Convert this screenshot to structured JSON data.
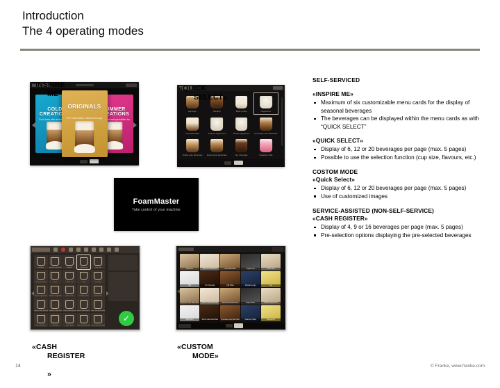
{
  "header": {
    "title_line1": "Introduction",
    "title_line2": "The 4 operating modes"
  },
  "captions": {
    "inspire_me": "\"INSPIRE",
    "inspire_me_cont": "ME\"",
    "quick_select": "«QUICK",
    "quick_select_cont": "SELECT»",
    "cash_register": "«CASH",
    "cash_register_cont": "REGISTER",
    "cash_register_cont2": "»",
    "custom_mode": "«CUSTOM",
    "custom_mode_cont": "MODE»"
  },
  "screenshots": {
    "inspire": {
      "cards": [
        {
          "title": "COLD CREATIONS",
          "subtitle": "Cool down with refreshing iced beverages"
        },
        {
          "title": "ORIGINALS",
          "subtitle": "The Foammaster classic beverage range"
        },
        {
          "title": "SUMMER CREATIONS",
          "subtitle": "Fresh seasonal specialities for hot days"
        }
      ]
    },
    "quick_select": {
      "beverages": [
        "Espresso",
        "Ristretto",
        "Black Coffee",
        "Cappuccino",
        "Latte Macchiato",
        "Caramel Cappuccino",
        "Vanilla Cappuccino",
        "Chocolate Latte Macchiato",
        "Vanilla Latte Macchiato",
        "Mokka Latte Macchiato",
        "Hot Chocolate",
        "Strawberry Milk"
      ],
      "selected": "Cappuccino"
    },
    "foam_master": {
      "title": "FoamMaster",
      "subtitle": "Take control of your machine"
    },
    "cash_register": {
      "beverages": [
        "Espresso",
        "Espresso Macchiato",
        "Ristretto",
        "Cappuccino",
        "Caffe Latte",
        "Latte Macchiato",
        "Tea Pot",
        "Coffee Pot",
        "Milk",
        "Hot Water",
        "Vanilla Cappuccino",
        "Caramel Cappuccino",
        "Choco Latte",
        "Caramel Latte",
        "Mocha Latte",
        "Vanilla Latte Macchiato",
        "Caramel Latte Macchiato",
        "Choco Latte Macchiato",
        "Mocha Latte Macchiato",
        "Nut Latte Macchiato",
        "Hot Chocolate",
        "Chocolate",
        "Milk Foam",
        "Iced Latte Macchiato",
        "Iced Latte Macchiato"
      ],
      "selected": "Cappuccino",
      "confirm_icon": "check-icon"
    },
    "custom_mode": {
      "beverages": [
        "Espresso",
        "Espresso Macchiato",
        "Latte Macchiato",
        "Cappuccino",
        "Caffe Latte",
        "Milk",
        "Hot Chocolate",
        "Flat White",
        "Ristretto Lungo",
        "Tea",
        "Espresso Latte Macchiato",
        "Mocha Latte Macchiato",
        "Mocha Latte Macchiato",
        "Milky Coffee",
        "Vanilla Cappuccino",
        "Milk Foam",
        "Mocha Latte Macchiato",
        "Chocolate Latte Macchiato",
        "Steamed Coffee",
        "Cappuccino"
      ]
    }
  },
  "body": {
    "section1_heading": "SELF-SERVICED",
    "section1_sub1": "«INSPIRE ME»",
    "section1_sub1_bullets": [
      "Maximum of six customizable menu cards for the display of seasonal beverages",
      "The beverages can be displayed within the menu cards as with “QUICK SELECT”"
    ],
    "section1_sub2": "«QUICK SELECT»",
    "section1_sub2_bullets": [
      "Display of 6, 12 or 20 beverages per page (max. 5 pages)",
      "Possible to use the selection function (cup size, flavours, etc.)"
    ],
    "section2_heading": "COSTOM MODE",
    "section2_sub1": "«Quick Select»",
    "section2_sub1_bullets": [
      "Display of 6, 12 or 20 beverages per page (max. 5 pages)",
      "Use of customized images"
    ],
    "section3_heading": "SERVICE-ASSISTED (NON-SELF-SERVICE)",
    "section3_sub1": "«CASH REGISTER»",
    "section3_sub1_bullets": [
      "Display of 4, 9 or 16 beverages per page (max. 5 pages)",
      "Pre-selection options displaying the pre-selected beverages"
    ]
  },
  "footer": {
    "page_number": "14",
    "copyright": "© Franke, www.franke.com"
  },
  "colors": {
    "rule": "#85857a",
    "card_cold": "#18a9cf",
    "card_originals": "#d8aa4b",
    "card_summer": "#e2398c",
    "confirm_green": "#2ecc40"
  }
}
